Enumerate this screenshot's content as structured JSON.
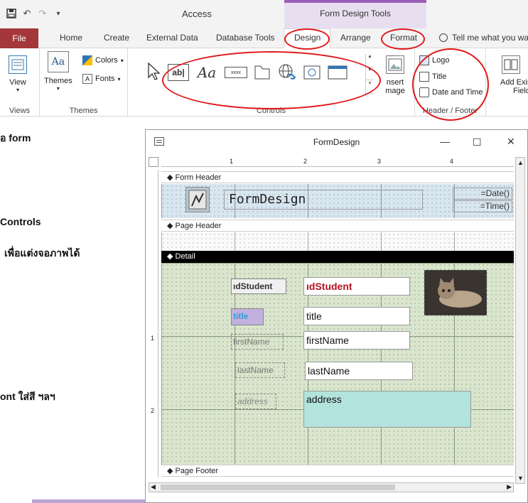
{
  "app": {
    "title": "Access",
    "contextual_title": "Form Design Tools"
  },
  "tabs": [
    "File",
    "Home",
    "Create",
    "External Data",
    "Database Tools",
    "Design",
    "Arrange",
    "Format"
  ],
  "tell_me": "Tell me what you war",
  "ribbon": {
    "views": {
      "view_label": "View",
      "group": "Views"
    },
    "themes": {
      "themes_label": "Themes",
      "colors_label": "Colors",
      "fonts_label": "Fonts",
      "group": "Themes"
    },
    "controls": {
      "group": "Controls",
      "textbox_label": "ab|",
      "label_control": "Aa",
      "button_caption": "xxxx",
      "insert_image": "Insert Image",
      "insert_image_line1": "nsert",
      "insert_image_line2": "mage"
    },
    "header_footer": {
      "logo": "Logo",
      "title": "Title",
      "date_time": "Date and Time",
      "group": "Header / Footer"
    },
    "add_existing": {
      "line1": "Add Exis",
      "line2": "Field"
    }
  },
  "background_text": {
    "line1": "อ form",
    "line2": "Controls",
    "line3": "เพื่อแต่งจอภาพได้",
    "line4": "ont ใส่สี  ฯลฯ"
  },
  "window": {
    "title": "FormDesign",
    "ruler_marks": [
      "1",
      "2",
      "3",
      "4"
    ],
    "left_ruler_marks": [
      "1",
      "2"
    ],
    "sections": {
      "form_header": "Form Header",
      "page_header": "Page Header",
      "detail": "Detail",
      "page_footer": "Page Footer"
    },
    "header": {
      "title": "FormDesign",
      "date": "=Date()",
      "time": "=Time()"
    },
    "fields": [
      {
        "label": "ıdStudent",
        "value": "ıdStudent"
      },
      {
        "label": "title",
        "value": "title"
      },
      {
        "label": "firstName",
        "value": "firstName"
      },
      {
        "label": "lastName",
        "value": "lastName"
      },
      {
        "label": "address",
        "value": "address"
      }
    ]
  },
  "colors": {
    "file_tab": "#a4373a",
    "annotation": "#e01919",
    "detail_grid": "#d9e6cd",
    "address_box": "#b2e3dc",
    "title_label_bg": "#c2b1de"
  }
}
